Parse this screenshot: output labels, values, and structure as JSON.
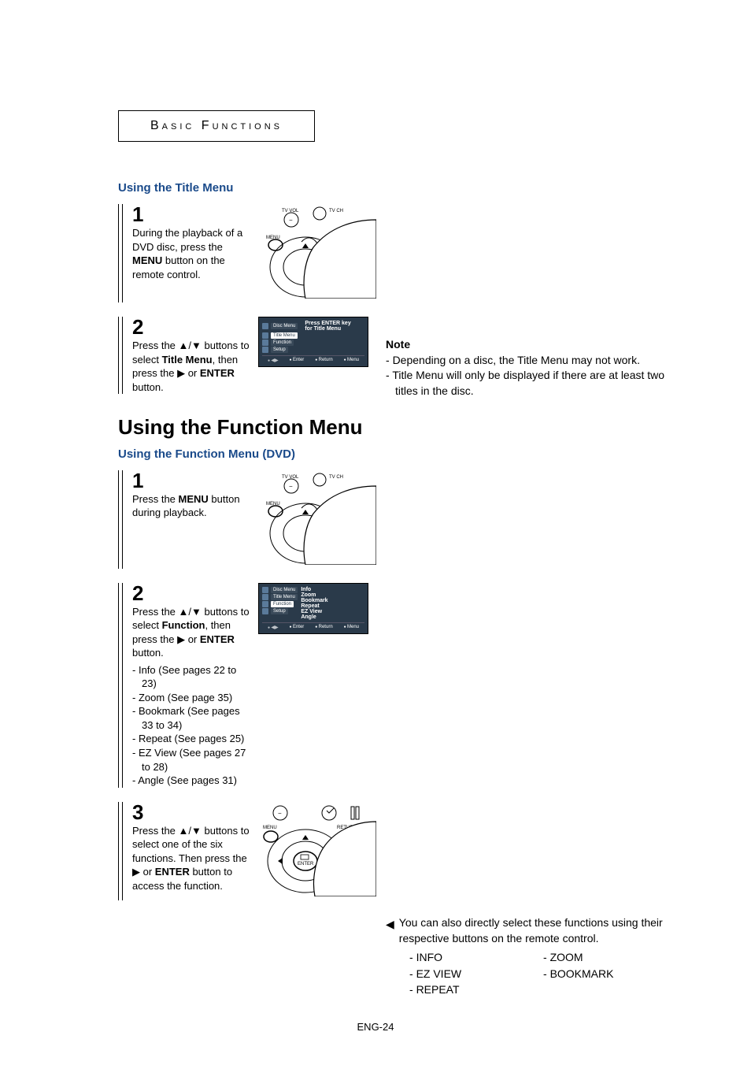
{
  "header": {
    "title": "Basic Functions"
  },
  "titleMenu": {
    "heading": "Using the Title Menu",
    "step1": {
      "num": "1",
      "p1": "During the playback of a DVD disc, press the ",
      "bold": "MENU",
      "p2": " button on the remote control."
    },
    "step2": {
      "num": "2",
      "p1": "Press the ▲/▼ buttons to select ",
      "bold1": "Title Menu",
      "p2": ", then press the ▶ or ",
      "bold2": "ENTER",
      "p3": " button."
    },
    "osd": {
      "items": [
        "Disc Menu",
        "Title Menu",
        "Function",
        "Setup"
      ],
      "msg1": "Press ENTER key",
      "msg2": "for Title Menu",
      "footer": [
        "Enter",
        "Return",
        "Menu"
      ]
    },
    "note": {
      "title": "Note",
      "li1": "Depending on a disc, the Title Menu may not work.",
      "li2": "Title Menu will only be displayed if there are at least two titles in the disc."
    }
  },
  "functionMenu": {
    "mainHeading": "Using the Function Menu",
    "subHeading": "Using the Function Menu (DVD)",
    "step1": {
      "num": "1",
      "p1": "Press the ",
      "bold": "MENU",
      "p2": " button during playback."
    },
    "step2": {
      "num": "2",
      "p1": "Press the ▲/▼ buttons to select ",
      "bold1": "Function",
      "p2": ", then press the ▶ or ",
      "bold2": "ENTER",
      "p3": " button.",
      "bullets": [
        "Info (See pages 22 to 23)",
        "Zoom (See page 35)",
        "Bookmark (See pages 33 to 34)",
        "Repeat (See pages 25)",
        "EZ View (See pages 27 to 28)",
        "Angle (See pages 31)"
      ]
    },
    "osd": {
      "left": [
        "Disc Menu",
        "Title Menu",
        "Function",
        "Setup"
      ],
      "right": [
        "Info",
        "Zoom",
        "Bookmark",
        "Repeat",
        "EZ View",
        "Angle"
      ],
      "footer": [
        "Enter",
        "Return",
        "Menu"
      ]
    },
    "step3": {
      "num": "3",
      "p1": "Press the ▲/▼ buttons to select one of the six functions. Then press the ▶ or ",
      "bold": "ENTER",
      "p2": " button to access the function."
    },
    "direct": {
      "lead": "You can also directly select these functions using their respective buttons on the remote control.",
      "col1": [
        "INFO",
        "EZ VIEW",
        "REPEAT"
      ],
      "col2": [
        "ZOOM",
        "BOOKMARK"
      ]
    }
  },
  "remoteLabels": {
    "tvvol": "TV VOL",
    "tvch": "TV CH",
    "menu": "MENU",
    "return": "RETURN",
    "enter": "ENTER"
  },
  "pageNum": "ENG-24"
}
